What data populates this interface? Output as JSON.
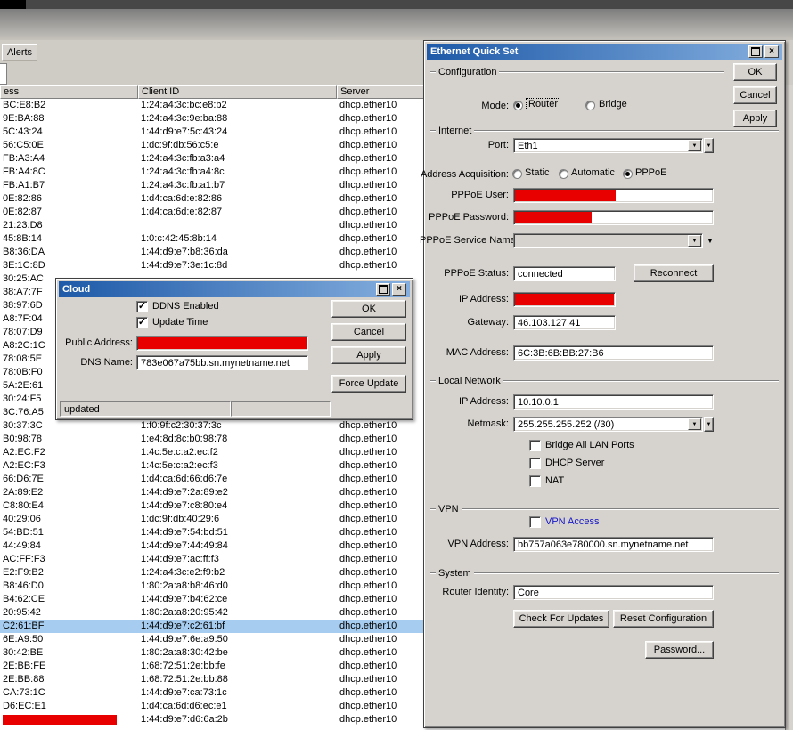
{
  "colors": {
    "redaction": "#e80000",
    "selection": "#a6cdf0",
    "titlebar_start": "#1e5aa8",
    "titlebar_end": "#84aede",
    "dialog_face": "#d6d3ce"
  },
  "icons": {
    "close": "×",
    "dropdown": "▼",
    "check": "✓"
  },
  "alerts_tab": {
    "label": "Alerts"
  },
  "table": {
    "headers": [
      "ess",
      "Client ID",
      "Server"
    ],
    "rows": [
      {
        "mac": "BC:E8:B2",
        "client_id": "1:24:a4:3c:bc:e8:b2",
        "server": "dhcp.ether10"
      },
      {
        "mac": "9E:BA:88",
        "client_id": "1:24:a4:3c:9e:ba:88",
        "server": "dhcp.ether10"
      },
      {
        "mac": "5C:43:24",
        "client_id": "1:44:d9:e7:5c:43:24",
        "server": "dhcp.ether10"
      },
      {
        "mac": "56:C5:0E",
        "client_id": "1:dc:9f:db:56:c5:e",
        "server": "dhcp.ether10"
      },
      {
        "mac": "FB:A3:A4",
        "client_id": "1:24:a4:3c:fb:a3:a4",
        "server": "dhcp.ether10"
      },
      {
        "mac": "FB:A4:8C",
        "client_id": "1:24:a4:3c:fb:a4:8c",
        "server": "dhcp.ether10"
      },
      {
        "mac": "FB:A1:B7",
        "client_id": "1:24:a4:3c:fb:a1:b7",
        "server": "dhcp.ether10"
      },
      {
        "mac": "0E:82:86",
        "client_id": "1:d4:ca:6d:e:82:86",
        "server": "dhcp.ether10"
      },
      {
        "mac": "0E:82:87",
        "client_id": "1:d4:ca:6d:e:82:87",
        "server": "dhcp.ether10"
      },
      {
        "mac": "21:23:D8",
        "client_id": "",
        "server": "dhcp.ether10"
      },
      {
        "mac": "45:8B:14",
        "client_id": "1:0:c:42:45:8b:14",
        "server": "dhcp.ether10"
      },
      {
        "mac": "B8:36:DA",
        "client_id": "1:44:d9:e7:b8:36:da",
        "server": "dhcp.ether10"
      },
      {
        "mac": "3E:1C:8D",
        "client_id": "1:44:d9:e7:3e:1c:8d",
        "server": "dhcp.ether10"
      },
      {
        "mac": "30:25:AC",
        "client_id": "",
        "server": ""
      },
      {
        "mac": "38:A7:7F",
        "client_id": "",
        "server": ""
      },
      {
        "mac": "38:97:6D",
        "client_id": "",
        "server": ""
      },
      {
        "mac": "A8:7F:04",
        "client_id": "",
        "server": ""
      },
      {
        "mac": "78:07:D9",
        "client_id": "",
        "server": ""
      },
      {
        "mac": "A8:2C:1C",
        "client_id": "",
        "server": ""
      },
      {
        "mac": "78:08:5E",
        "client_id": "",
        "server": ""
      },
      {
        "mac": "78:0B:F0",
        "client_id": "",
        "server": ""
      },
      {
        "mac": "5A:2E:61",
        "client_id": "",
        "server": ""
      },
      {
        "mac": "30:24:F5",
        "client_id": "",
        "server": ""
      },
      {
        "mac": "3C:76:A5",
        "client_id": "",
        "server": ""
      },
      {
        "mac": "30:37:3C",
        "client_id": "1:f0:9f:c2:30:37:3c",
        "server": "dhcp.ether10"
      },
      {
        "mac": "B0:98:78",
        "client_id": "1:e4:8d:8c:b0:98:78",
        "server": "dhcp.ether10"
      },
      {
        "mac": "A2:EC:F2",
        "client_id": "1:4c:5e:c:a2:ec:f2",
        "server": "dhcp.ether10"
      },
      {
        "mac": "A2:EC:F3",
        "client_id": "1:4c:5e:c:a2:ec:f3",
        "server": "dhcp.ether10"
      },
      {
        "mac": "66:D6:7E",
        "client_id": "1:d4:ca:6d:66:d6:7e",
        "server": "dhcp.ether10"
      },
      {
        "mac": "2A:89:E2",
        "client_id": "1:44:d9:e7:2a:89:e2",
        "server": "dhcp.ether10"
      },
      {
        "mac": "C8:80:E4",
        "client_id": "1:44:d9:e7:c8:80:e4",
        "server": "dhcp.ether10"
      },
      {
        "mac": "40:29:06",
        "client_id": "1:dc:9f:db:40:29:6",
        "server": "dhcp.ether10"
      },
      {
        "mac": "54:BD:51",
        "client_id": "1:44:d9:e7:54:bd:51",
        "server": "dhcp.ether10"
      },
      {
        "mac": "44:49:84",
        "client_id": "1:44:d9:e7:44:49:84",
        "server": "dhcp.ether10"
      },
      {
        "mac": "AC:FF:F3",
        "client_id": "1:44:d9:e7:ac:ff:f3",
        "server": "dhcp.ether10"
      },
      {
        "mac": "E2:F9:B2",
        "client_id": "1:24:a4:3c:e2:f9:b2",
        "server": "dhcp.ether10"
      },
      {
        "mac": "B8:46:D0",
        "client_id": "1:80:2a:a8:b8:46:d0",
        "server": "dhcp.ether10"
      },
      {
        "mac": "B4:62:CE",
        "client_id": "1:44:d9:e7:b4:62:ce",
        "server": "dhcp.ether10"
      },
      {
        "mac": "20:95:42",
        "client_id": "1:80:2a:a8:20:95:42",
        "server": "dhcp.ether10"
      },
      {
        "mac": "C2:61:BF",
        "client_id": "1:44:d9:e7:c2:61:bf",
        "server": "dhcp.ether10",
        "selected": true
      },
      {
        "mac": "6E:A9:50",
        "client_id": "1:44:d9:e7:6e:a9:50",
        "server": "dhcp.ether10"
      },
      {
        "mac": "30:42:BE",
        "client_id": "1:80:2a:a8:30:42:be",
        "server": "dhcp.ether10"
      },
      {
        "mac": "2E:BB:FE",
        "client_id": "1:68:72:51:2e:bb:fe",
        "server": "dhcp.ether10"
      },
      {
        "mac": "2E:BB:88",
        "client_id": "1:68:72:51:2e:bb:88",
        "server": "dhcp.ether10"
      },
      {
        "mac": "CA:73:1C",
        "client_id": "1:44:d9:e7:ca:73:1c",
        "server": "dhcp.ether10"
      },
      {
        "mac": "D6:EC:E1",
        "client_id": "1:d4:ca:6d:d6:ec:e1",
        "server": "dhcp.ether10"
      },
      {
        "mac": "",
        "client_id": "1:44:d9:e7:d6:6a:2b",
        "server": "dhcp.ether10",
        "mac_redacted": true
      }
    ]
  },
  "cloud": {
    "title": "Cloud",
    "ddns_enabled": "DDNS Enabled",
    "update_time": "Update Time",
    "public_address_label": "Public Address:",
    "dns_name_label": "DNS Name:",
    "dns_name_value": "783e067a75bb.sn.mynetname.net",
    "ok": "OK",
    "cancel": "Cancel",
    "apply": "Apply",
    "force_update": "Force Update",
    "status": "updated"
  },
  "quickset": {
    "title": "Ethernet Quick Set",
    "ok": "OK",
    "cancel": "Cancel",
    "apply": "Apply",
    "section_configuration": "Configuration",
    "mode_label": "Mode:",
    "mode_router": "Router",
    "mode_bridge": "Bridge",
    "mode_selected": "Router",
    "section_internet": "Internet",
    "port_label": "Port:",
    "port_value": "Eth1",
    "addr_acq_label": "Address Acquisition:",
    "addr_static": "Static",
    "addr_automatic": "Automatic",
    "addr_pppoe": "PPPoE",
    "addr_selected": "PPPoE",
    "pppoe_user_label": "PPPoE User:",
    "pppoe_password_label": "PPPoE Password:",
    "pppoe_service_label": "PPPoE Service Name:",
    "pppoe_status_label": "PPPoE Status:",
    "pppoe_status_value": "connected",
    "reconnect": "Reconnect",
    "wan_ip_label": "IP Address:",
    "gateway_label": "Gateway:",
    "gateway_value": "46.103.127.41",
    "mac_label": "MAC Address:",
    "mac_value": "6C:3B:6B:BB:27:B6",
    "section_local": "Local Network",
    "lan_ip_label": "IP Address:",
    "lan_ip_value": "10.10.0.1",
    "netmask_label": "Netmask:",
    "netmask_value": "255.255.255.252 (/30)",
    "chk_bridge_all": "Bridge All LAN Ports",
    "chk_dhcp_server": "DHCP Server",
    "chk_nat": "NAT",
    "section_vpn": "VPN",
    "vpn_access": "VPN Access",
    "vpn_address_label": "VPN Address:",
    "vpn_address_value": "bb757a063e780000.sn.mynetname.net",
    "section_system": "System",
    "router_identity_label": "Router Identity:",
    "router_identity_value": "Core",
    "check_updates": "Check For Updates",
    "reset_config": "Reset Configuration",
    "password": "Password..."
  }
}
